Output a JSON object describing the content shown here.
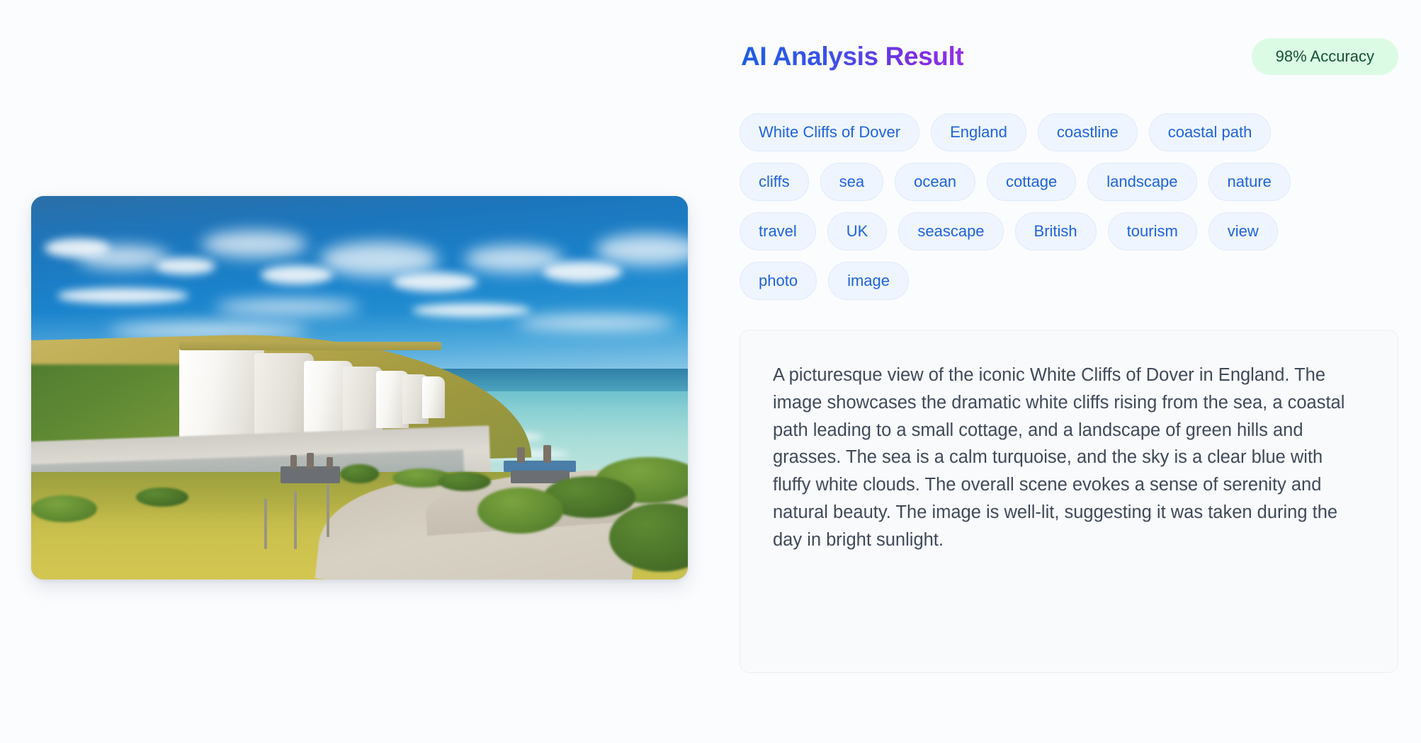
{
  "header": {
    "title": "AI Analysis Result",
    "accuracy_badge": "98% Accuracy",
    "title_gradient_start": "#1d5fe0",
    "title_gradient_end": "#9333ea",
    "badge_bg": "#dcfbe5",
    "badge_text_color": "#14532d"
  },
  "tags": [
    "White Cliffs of Dover",
    "England",
    "coastline",
    "coastal path",
    "cliffs",
    "sea",
    "ocean",
    "cottage",
    "landscape",
    "nature",
    "travel",
    "UK",
    "seascape",
    "British",
    "tourism",
    "view",
    "photo",
    "image"
  ],
  "tag_style": {
    "background": "#eef5fe",
    "border": "#dfeafb",
    "text_color": "#1f63d8"
  },
  "description": {
    "text": "A picturesque view of the iconic White Cliffs of Dover in England. The image showcases the dramatic white cliffs rising from the sea, a coastal path leading to a small cottage, and a landscape of green hills and grasses. The sea is a calm turquoise, and the sky is a clear blue with fluffy white clouds. The overall scene evokes a sense of serenity and natural beauty. The image is well-lit, suggesting it was taken during the day in bright sunlight.",
    "background": "#f9fafb",
    "text_color": "#3f4a5a"
  },
  "photo": {
    "alt": "White Cliffs of Dover coastal landscape with chalk cliffs, turquoise sea, blue sky with clouds, a coastal path and a small cottage",
    "page_background": "#fbfcfe"
  }
}
